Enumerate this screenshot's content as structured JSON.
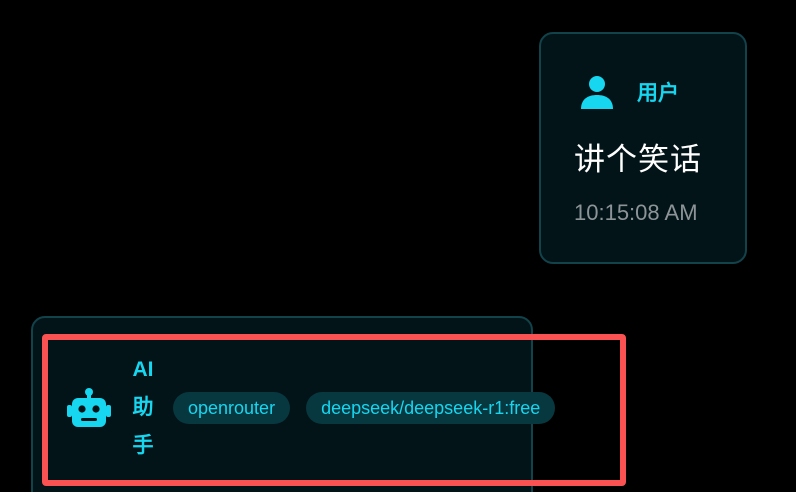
{
  "user_message": {
    "role_label": "用户",
    "icon": "user-icon",
    "text": "讲个笑话",
    "timestamp": "10:15:08 AM"
  },
  "ai_message": {
    "role_label_lines": [
      "AI",
      "助",
      "手"
    ],
    "icon": "robot-icon",
    "provider_tag": "openrouter",
    "model_tag": "deepseek/deepseek-r1:free"
  },
  "colors": {
    "background": "#000000",
    "card_background": "#021418",
    "card_border": "#12424a",
    "accent": "#16d6f0",
    "tag_background": "#07383f",
    "timestamp": "#8c9498",
    "highlight": "#fa5252"
  }
}
